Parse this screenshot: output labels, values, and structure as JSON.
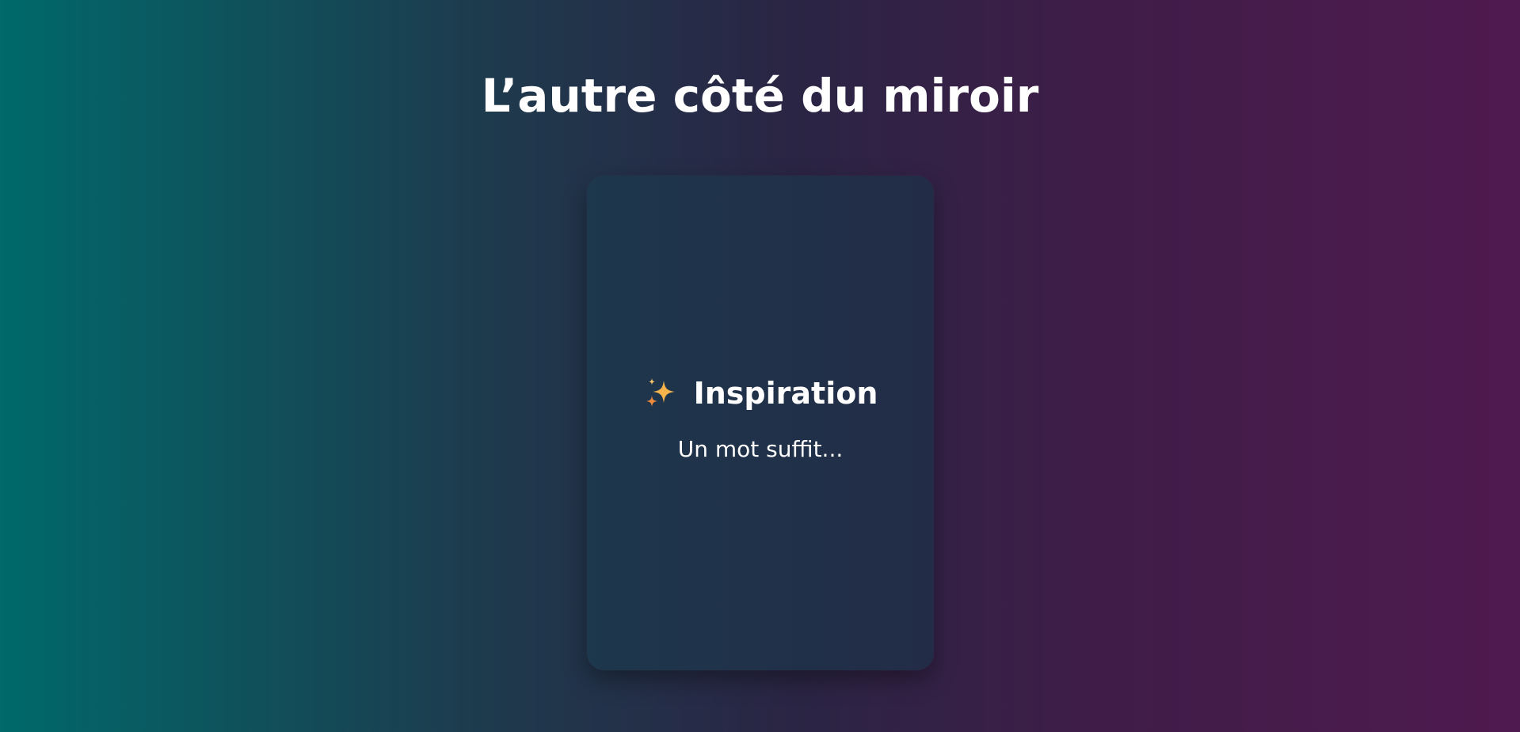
{
  "page": {
    "title": "L’autre côté du miroir"
  },
  "card": {
    "icon": "sparkles-icon",
    "title": "Inspiration",
    "subtitle": "Un mot suffit..."
  },
  "colors": {
    "gradient_left": "#00696a",
    "gradient_right": "#4f1a4f",
    "card_background": "#1f334a",
    "sparkle_primary": "#f7b44a",
    "sparkle_secondary": "#f08a3c",
    "text": "#ffffff"
  }
}
